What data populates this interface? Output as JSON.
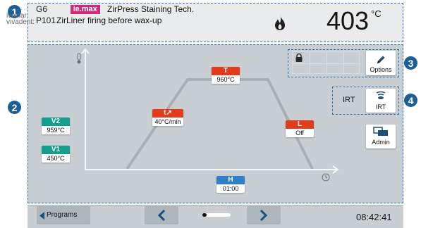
{
  "header": {
    "logo_line1": "ivoclar",
    "logo_line2": "vivadent:",
    "program_slot": "G6",
    "program_number": "P101",
    "material_badge_prefix": "İ",
    "material_badge": "e.max",
    "program_title": "ZirPress Staining Tech.",
    "program_subtitle": "ZirLiner firing before wax-up",
    "furnace_temperature": "403",
    "temperature_unit": "°C",
    "flame_icon": "flame-icon"
  },
  "markers": [
    "1",
    "2",
    "3",
    "4"
  ],
  "firing_curve": {
    "vacuum2": {
      "label": "V2",
      "value": "959°C"
    },
    "vacuum1": {
      "label": "V1",
      "value": "450°C"
    },
    "heat_rate": {
      "label": "t↗",
      "value": "40°C/min"
    },
    "holding_temp": {
      "label": "T",
      "value": "960°C"
    },
    "long_term_cooling": {
      "label": "L",
      "value": "Off"
    },
    "holding_time": {
      "label": "H",
      "value": "01:00"
    },
    "y_axis_icon": "thermometer-icon",
    "x_axis_icon": "clock-icon"
  },
  "side_panel": {
    "options_label": "Options",
    "irt_text": "IRT",
    "irt_button_label": "IRT",
    "admin_label": "Admin"
  },
  "footer": {
    "programs_label": "Programs",
    "previous_icon": "chevron-left-icon",
    "next_icon": "chevron-right-icon",
    "page_progress": 0.15,
    "time": "08:42:41"
  },
  "colors": {
    "red": "#e23c1c",
    "teal": "#129f8c",
    "blue": "#2f80cb",
    "badge": "#cf2c77",
    "marker": "#1b5f96"
  }
}
